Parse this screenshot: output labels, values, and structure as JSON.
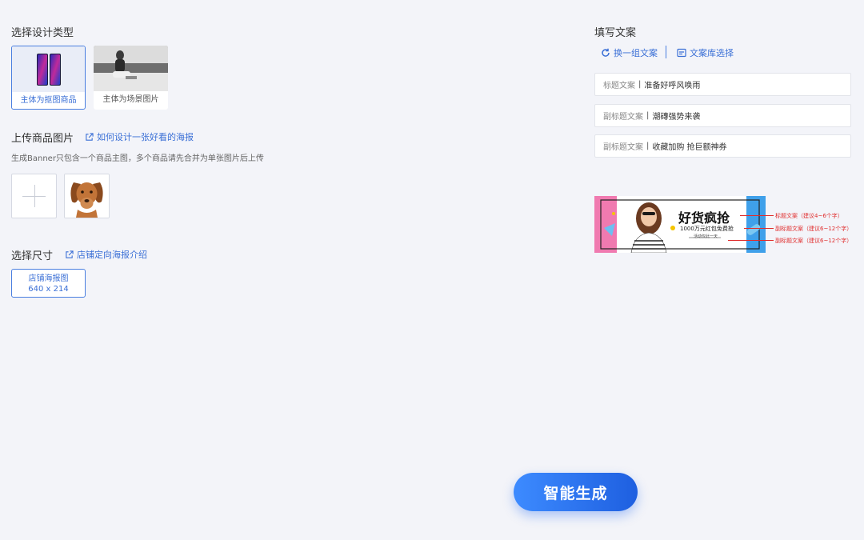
{
  "left": {
    "design_type_title": "选择设计类型",
    "design_types": [
      {
        "label": "主体为抠图商品",
        "active": true
      },
      {
        "label": "主体为场景图片",
        "active": false
      }
    ],
    "upload_title": "上传商品图片",
    "upload_help_link": "如何设计一张好看的海报",
    "upload_hint": "生成Banner只包含一个商品主图，多个商品请先合并为单张图片后上传",
    "size_title": "选择尺寸",
    "size_help_link": "店铺定向海报介绍",
    "size_option": {
      "name": "店铺海报图",
      "dims": "640 x 214"
    }
  },
  "right": {
    "copy_title": "填写文案",
    "swap_copy": "换一组文案",
    "copy_library": "文案库选择",
    "fields": [
      {
        "label": "标题文案",
        "value": "准备好呼风唤雨"
      },
      {
        "label": "副标题文案",
        "value": "潮磚强势来袭"
      },
      {
        "label": "副标题文案",
        "value": "收藏加购 抢巨额神券"
      }
    ],
    "banner_preview": {
      "headline": "好货疯抢",
      "subline": "1000万元红包免费抢",
      "small": "活动仅此一天"
    },
    "annotations": [
      "标题文案（建议4~6个字）",
      "副标题文案（建议6~12个字）",
      "副标题文案（建议6~12个字）"
    ]
  },
  "generate_button": "智能生成"
}
